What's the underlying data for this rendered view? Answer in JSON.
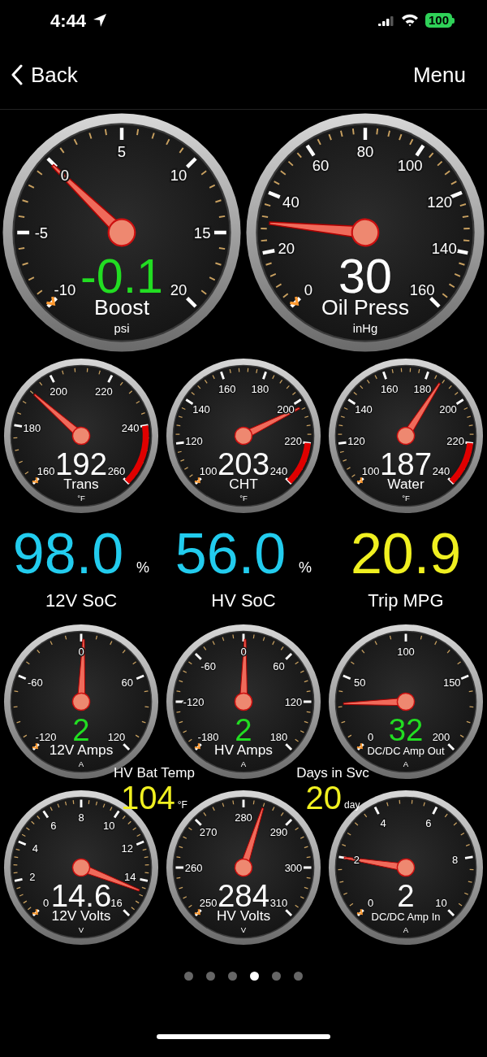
{
  "status_bar": {
    "time": "4:44",
    "battery": "100"
  },
  "nav": {
    "back": "Back",
    "menu": "Menu"
  },
  "top_gauges": [
    {
      "label": "Boost",
      "unit": "psi",
      "value": "-0.1",
      "color": "#22dd22",
      "ticks": [
        "-10",
        "-5",
        "0",
        "5",
        "10",
        "15",
        "20"
      ]
    },
    {
      "label": "Oil Press",
      "unit": "inHg",
      "value": "30",
      "color": "#ffffff",
      "ticks": [
        "0",
        "20",
        "40",
        "60",
        "80",
        "100",
        "120",
        "140",
        "160"
      ]
    }
  ],
  "middle_gauges": [
    {
      "label": "Trans",
      "unit": "°F",
      "value": "192",
      "color": "#ffffff",
      "warning_zone": true,
      "ticks": [
        "160",
        "180",
        "200",
        "220",
        "240",
        "260"
      ]
    },
    {
      "label": "CHT",
      "unit": "°F",
      "value": "203",
      "color": "#ffffff",
      "warning_zone": true,
      "ticks": [
        "100",
        "120",
        "140",
        "160",
        "180",
        "200",
        "220",
        "240"
      ]
    },
    {
      "label": "Water",
      "unit": "°F",
      "value": "187",
      "color": "#ffffff",
      "warning_zone": true,
      "ticks": [
        "100",
        "120",
        "140",
        "160",
        "180",
        "200",
        "220",
        "240"
      ]
    }
  ],
  "readouts": [
    {
      "value": "98.0",
      "unit": "%",
      "label": "12V SoC",
      "color": "#22ccee"
    },
    {
      "value": "56.0",
      "unit": "%",
      "label": "HV SoC",
      "color": "#22ccee"
    },
    {
      "value": "20.9",
      "label": "Trip MPG",
      "color": "#f0f020"
    }
  ],
  "lower_gauges": [
    {
      "label": "12V Amps",
      "unit": "A",
      "value": "2",
      "color": "#22dd22",
      "ticks": [
        "-120",
        "-60",
        "0",
        "60",
        "120"
      ]
    },
    {
      "label": "HV Amps",
      "unit": "A",
      "value": "2",
      "color": "#22dd22",
      "ticks": [
        "-180",
        "-120",
        "-60",
        "0",
        "60",
        "120",
        "180"
      ]
    },
    {
      "label": "DC/DC Amp Out",
      "unit": "A",
      "value": "32",
      "color": "#22dd22",
      "ticks": [
        "0",
        "50",
        "100",
        "150",
        "200"
      ]
    }
  ],
  "small_readouts": [
    {
      "label": "HV Bat Temp",
      "value": "104",
      "unit": "°F"
    },
    {
      "label": "Days in Svc",
      "value": "20",
      "unit": "day"
    }
  ],
  "bottom_gauges": [
    {
      "label": "12V Volts",
      "unit": "V",
      "value": "14.6",
      "color": "#ffffff",
      "ticks": [
        "0",
        "2",
        "4",
        "6",
        "8",
        "10",
        "12",
        "14",
        "16"
      ]
    },
    {
      "label": "HV Volts",
      "unit": "V",
      "value": "284",
      "color": "#ffffff",
      "ticks": [
        "250",
        "260",
        "270",
        "280",
        "290",
        "300",
        "310"
      ]
    },
    {
      "label": "DC/DC Amp In",
      "unit": "A",
      "value": "2",
      "color": "#ffffff",
      "ticks": [
        "0",
        "2",
        "4",
        "6",
        "8",
        "10"
      ]
    }
  ],
  "pages": [
    {
      "selected": false
    },
    {
      "selected": false
    },
    {
      "selected": false
    },
    {
      "selected": true
    },
    {
      "selected": false
    },
    {
      "selected": false
    }
  ]
}
